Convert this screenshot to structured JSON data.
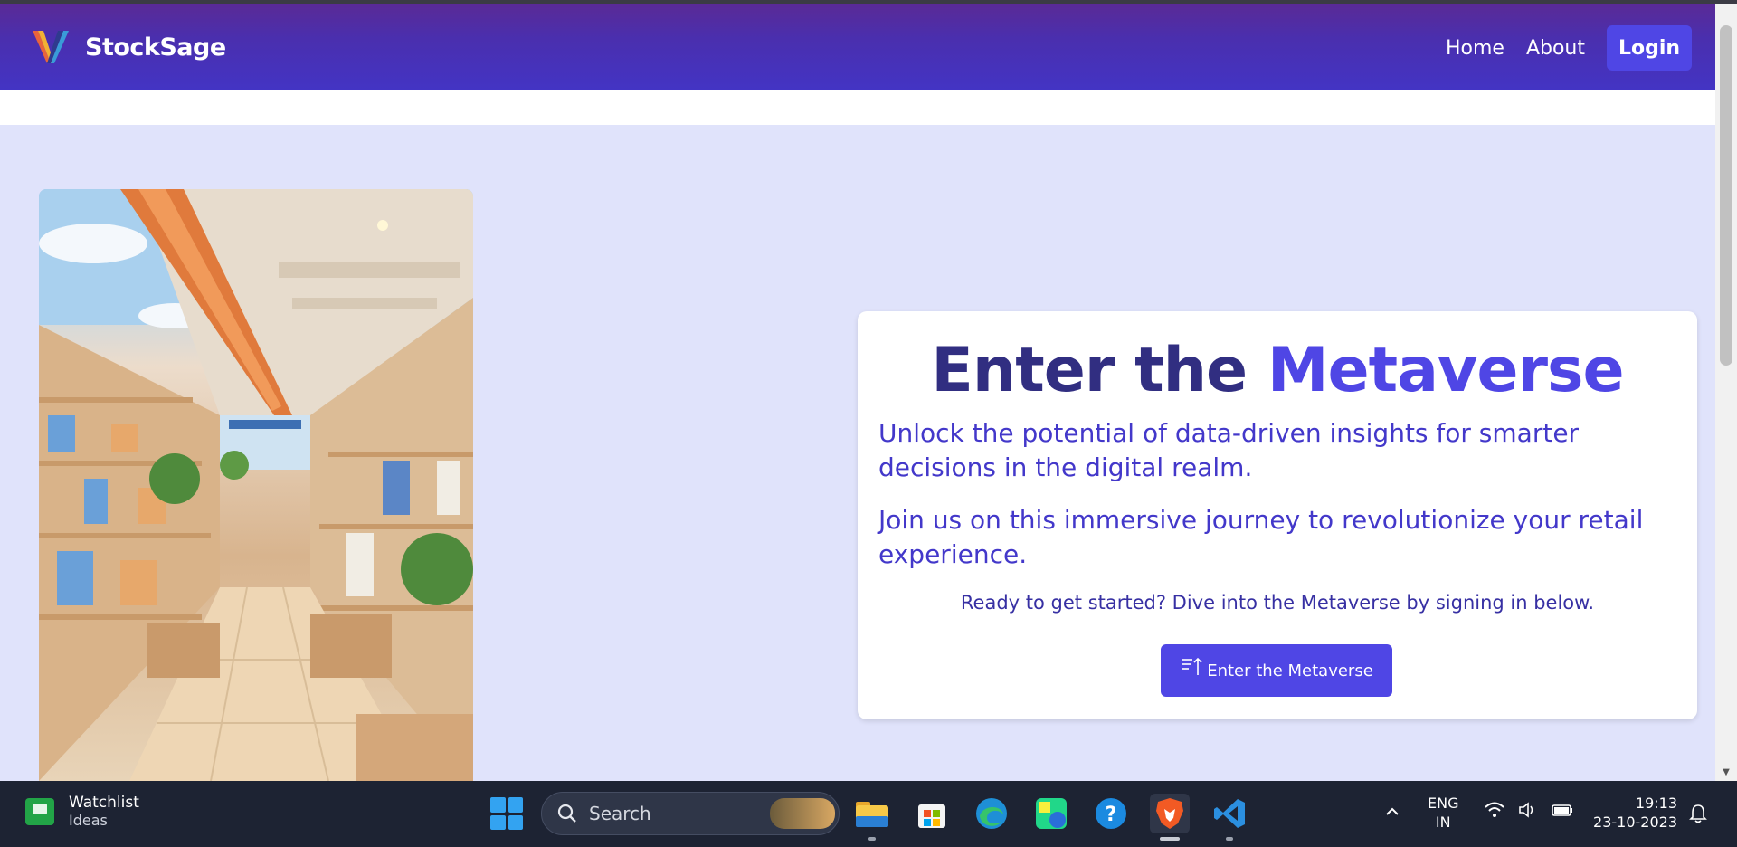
{
  "app": {
    "brand_name": "StockSage",
    "colors": {
      "primary": "#4f46e5",
      "dark_indigo": "#312e81",
      "page_bg": "#e0e3fb"
    }
  },
  "nav": {
    "home": "Home",
    "about": "About",
    "login": "Login"
  },
  "hero": {
    "image_icon": "retail-store-illustration",
    "title_part1": "Enter the",
    "title_part2": "Metaverse",
    "paragraph1": "Unlock the potential of data-driven insights for smarter decisions in the digital realm.",
    "paragraph2": "Join us on this immersive journey to revolutionize your retail experience.",
    "cta_text": "Ready to get started? Dive into the Metaverse by signing in below.",
    "button_label": "Enter the Metaverse",
    "button_icon": "sort-up-icon"
  },
  "taskbar": {
    "widget_title": "Watchlist",
    "widget_subtitle": "Ideas",
    "search_placeholder": "Search",
    "lang_line1": "ENG",
    "lang_line2": "IN",
    "time": "19:13",
    "date": "23-10-2023"
  }
}
